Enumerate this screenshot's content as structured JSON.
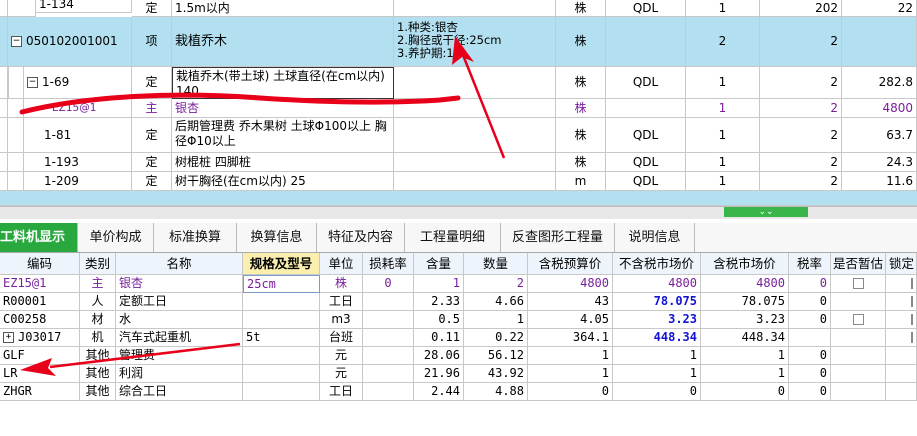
{
  "upper": {
    "rows": [
      {
        "code": "1-134",
        "type": "定",
        "name": "1.5m以内",
        "unit": "株",
        "qdl": "QDL",
        "a": "1",
        "b": "202",
        "c": "22"
      },
      {
        "code": "050102001001",
        "type": "项",
        "name": "栽植乔木",
        "feature1": "1.种类:银杏",
        "feature2": "2.胸径或干径:25cm",
        "feature3": "3.养护期:1年",
        "unit": "株",
        "a": "2",
        "b": "2"
      },
      {
        "code": "1-69",
        "type": "定",
        "name": "栽植乔木(带土球) 土球直径(在cm以内) 140",
        "unit": "株",
        "qdl": "QDL",
        "a": "1",
        "b": "2",
        "c": "282.8"
      },
      {
        "code": "EZ15@1",
        "type": "主",
        "name": "银杏",
        "unit": "株",
        "a": "1",
        "b": "2",
        "c": "4800"
      },
      {
        "code": "1-81",
        "type": "定",
        "name": "后期管理费 乔木果树 土球Φ100以上 胸径Φ10以上",
        "unit": "株",
        "qdl": "QDL",
        "a": "1",
        "b": "2",
        "c": "63.7"
      },
      {
        "code": "1-193",
        "type": "定",
        "name": "树棍桩 四脚桩",
        "unit": "株",
        "qdl": "QDL",
        "a": "1",
        "b": "2",
        "c": "24.3"
      },
      {
        "code": "1-209",
        "type": "定",
        "name": "树干胸径(在cm以内) 25",
        "unit": "m",
        "qdl": "QDL",
        "a": "1",
        "b": "2",
        "c": "11.6"
      }
    ]
  },
  "tabs": [
    "工料机显示",
    "单价构成",
    "标准换算",
    "换算信息",
    "特征及内容",
    "工程量明细",
    "反查图形工程量",
    "说明信息"
  ],
  "grid": {
    "headers": [
      "编码",
      "类别",
      "名称",
      "规格及型号",
      "单位",
      "损耗率",
      "含量",
      "数量",
      "含税预算价",
      "不含税市场价",
      "含税市场价",
      "税率",
      "是否暂估",
      "锁定"
    ],
    "rows": [
      {
        "code": "EZ15@1",
        "type": "主",
        "name": "银杏",
        "spec": "25cm",
        "unit": "株",
        "loss": "0",
        "content": "1",
        "qty": "2",
        "budget": "4800",
        "market_ex": "4800",
        "market_in": "4800",
        "tax": "0"
      },
      {
        "code": "R00001",
        "type": "人",
        "name": "定额工日",
        "spec": "",
        "unit": "工日",
        "loss": "",
        "content": "2.33",
        "qty": "4.66",
        "budget": "43",
        "market_ex": "78.075",
        "market_in": "78.075",
        "tax": "0"
      },
      {
        "code": "C00258",
        "type": "材",
        "name": "水",
        "spec": "",
        "unit": "m3",
        "loss": "",
        "content": "0.5",
        "qty": "1",
        "budget": "4.05",
        "market_ex": "3.23",
        "market_in": "3.23",
        "tax": "0"
      },
      {
        "code": "J03017",
        "type": "机",
        "name": "汽车式起重机",
        "spec": "5t",
        "unit": "台班",
        "loss": "",
        "content": "0.11",
        "qty": "0.22",
        "budget": "364.1",
        "market_ex": "448.34",
        "market_in": "448.34",
        "tax": ""
      },
      {
        "code": "GLF",
        "type": "其他",
        "name": "管理费",
        "spec": "",
        "unit": "元",
        "loss": "",
        "content": "28.06",
        "qty": "56.12",
        "budget": "1",
        "market_ex": "1",
        "market_in": "1",
        "tax": "0"
      },
      {
        "code": "LR",
        "type": "其他",
        "name": "利润",
        "spec": "",
        "unit": "元",
        "loss": "",
        "content": "21.96",
        "qty": "43.92",
        "budget": "1",
        "market_ex": "1",
        "market_in": "1",
        "tax": "0"
      },
      {
        "code": "ZHGR",
        "type": "其他",
        "name": "综合工日",
        "spec": "",
        "unit": "工日",
        "loss": "",
        "content": "2.44",
        "qty": "4.88",
        "budget": "0",
        "market_ex": "0",
        "market_in": "0",
        "tax": "0"
      }
    ]
  },
  "icons": {
    "expand": "+",
    "collapse": "−",
    "splitter": "⌄⌄"
  }
}
